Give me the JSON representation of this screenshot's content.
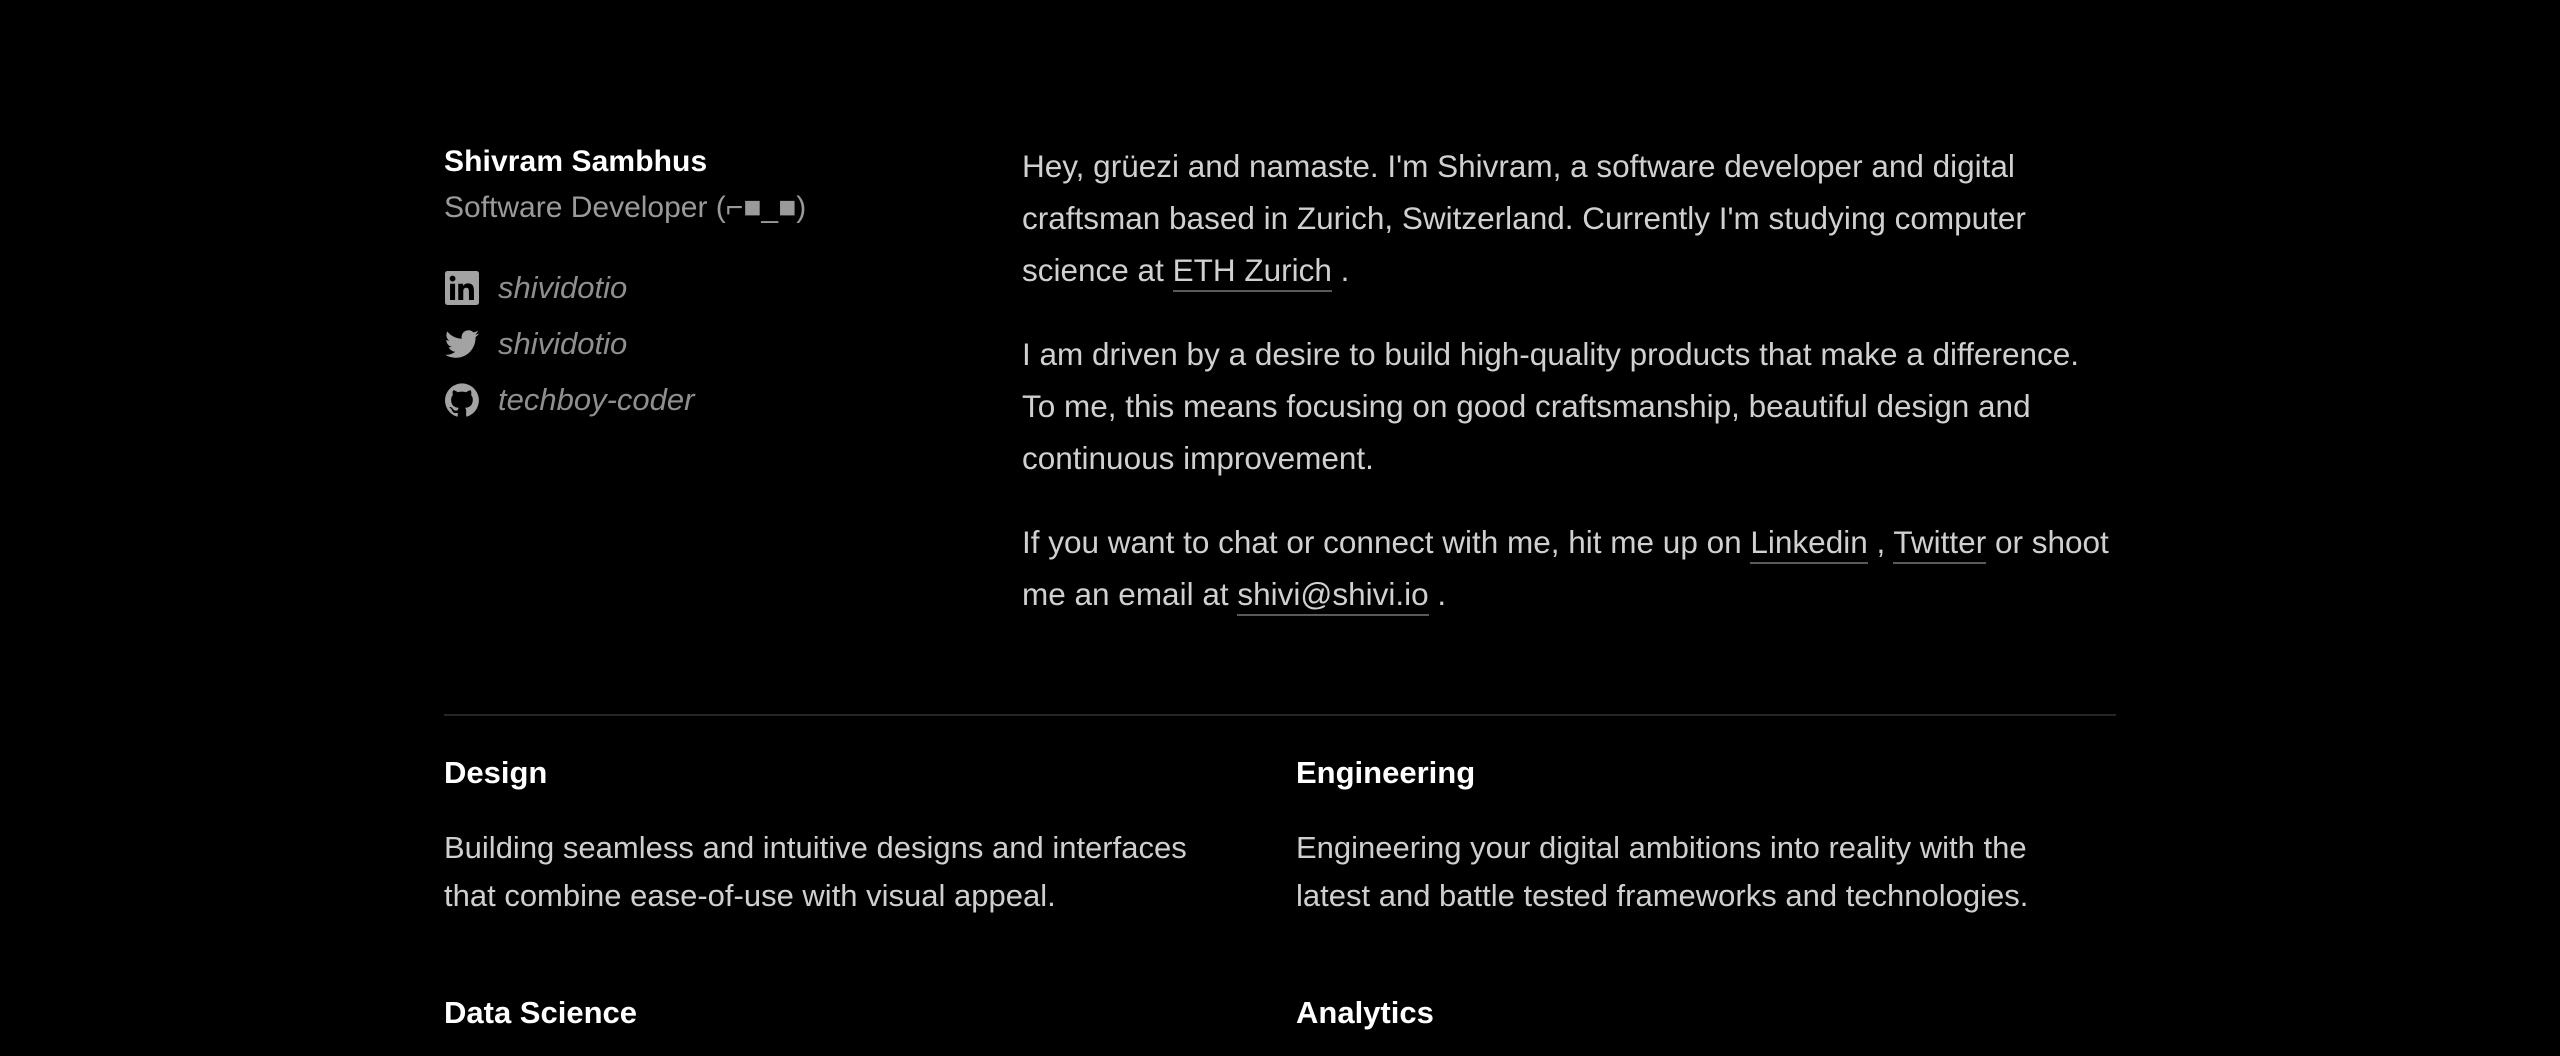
{
  "profile": {
    "name": "Shivram Sambhus",
    "role": "Software Developer (⌐■_■)"
  },
  "socials": [
    {
      "icon": "linkedin-icon",
      "handle": "shividotio"
    },
    {
      "icon": "twitter-icon",
      "handle": "shividotio"
    },
    {
      "icon": "github-icon",
      "handle": "techboy-coder"
    }
  ],
  "bio": {
    "p1_text": "Hey, grüezi and namaste. I'm Shivram, a software developer and digital craftsman based in Zurich, Switzerland. Currently I'm studying computer science at ",
    "p1_link": "ETH Zurich",
    "p1_end": " .",
    "p2": "I am driven by a desire to build high-quality products that make a difference. To me, this means focusing on good craftsmanship, beautiful design and continuous improvement.",
    "p3_text": "If you want to chat or connect with me, hit me up on ",
    "p3_link1": "Linkedin",
    "p3_sep": " , ",
    "p3_link2": "Twitter",
    "p3_mid": " or shoot me an email at ",
    "p3_email": "shivi@shivi.io",
    "p3_end": " ."
  },
  "services": [
    {
      "title": "Design",
      "description": "Building seamless and intuitive designs and interfaces that combine ease-of-use with visual appeal."
    },
    {
      "title": "Engineering",
      "description": "Engineering your digital ambitions into reality with the latest and battle tested frameworks and technologies."
    },
    {
      "title": "Data Science",
      "description": ""
    },
    {
      "title": "Analytics",
      "description": ""
    }
  ],
  "colors": {
    "background": "#000000",
    "heading": "#ffffff",
    "body_text": "#d0d0d0",
    "muted_text": "#9a9a9a",
    "divider": "#262626"
  }
}
